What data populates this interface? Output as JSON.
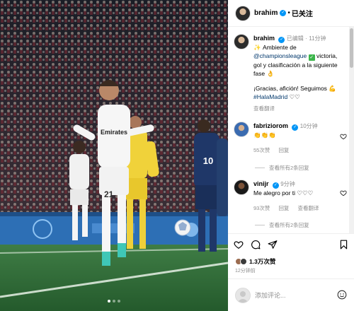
{
  "header": {
    "username": "brahim",
    "separator": "•",
    "follow_label": "已关注"
  },
  "caption": {
    "username": "brahim",
    "edited": "已编辑",
    "dot": "·",
    "time": "11分钟",
    "line1_prefix": "Ambiente de",
    "mention": "@championsleague",
    "line2_rest": "victoria, gol y clasificación a la siguiente fase",
    "line3": "¡Gracias, afición! Seguimos",
    "hashtag": "#HalaMadrid",
    "hearts": "♡♡",
    "translate": "查看翻译"
  },
  "comments": [
    {
      "username": "fabriziorom",
      "time": "10分钟",
      "text": "👏👏👏",
      "likes": "55次赞",
      "reply": "回复",
      "view_replies": "查看所有2条回复"
    },
    {
      "username": "vinijr",
      "time": "9分钟",
      "text": "Me alegro por ti ♡♡♡",
      "likes": "93次赞",
      "reply": "回复",
      "translate": "查看翻译",
      "view_replies": "查看所有2条回复"
    }
  ],
  "actions": {
    "likes": "1.3万次赞",
    "date": "12分钟前"
  },
  "compose": {
    "placeholder": "添加评论..."
  },
  "photo": {
    "jersey_text": "Emirates",
    "jersey_number": "21",
    "opponent_number": "10"
  },
  "colors": {
    "verified_blue": "#0095f6",
    "link": "#00376b",
    "muted": "#8e8e8e"
  }
}
